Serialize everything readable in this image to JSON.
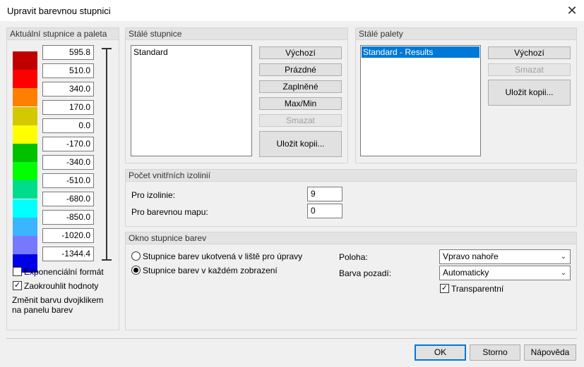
{
  "window": {
    "title": "Upravit barevnou stupnici"
  },
  "current": {
    "header": "Aktuální stupnice a paleta",
    "values": [
      "595.8",
      "510.0",
      "340.0",
      "170.0",
      "0.0",
      "-170.0",
      "-340.0",
      "-510.0",
      "-680.0",
      "-850.0",
      "-1020.0",
      "-1344.4"
    ],
    "colors": [
      "#c00000",
      "#ff0000",
      "#ff8000",
      "#d4c800",
      "#ffff00",
      "#00c000",
      "#00ff00",
      "#00dc8c",
      "#00ffff",
      "#3cb4ff",
      "#7878ff",
      "#0000e6"
    ],
    "exponential_label": "Exponenciální formát",
    "exponential_checked": false,
    "round_label": "Zaokrouhlit hodnoty",
    "round_checked": true,
    "hint": "Změnit barvu dvojklikem na panelu barev"
  },
  "scales": {
    "header": "Stálé stupnice",
    "items": [
      "Standard"
    ],
    "buttons": {
      "default": "Výchozí",
      "empty": "Prázdné",
      "filled": "Zaplněné",
      "maxmin": "Max/Min",
      "delete": "Smazat",
      "save_copy": "Uložit kopii..."
    }
  },
  "palettes": {
    "header": "Stálé palety",
    "items": [
      "Standard - Results"
    ],
    "buttons": {
      "default": "Výchozí",
      "delete": "Smazat",
      "save_copy": "Uložit kopii..."
    }
  },
  "isolines": {
    "header": "Počet vnitřních izolinií",
    "isolines_label": "Pro izolinie:",
    "isolines_value": "9",
    "colormap_label": "Pro barevnou mapu:",
    "colormap_value": "0"
  },
  "scale_window": {
    "header": "Okno stupnice barev",
    "radio1": "Stupnice barev ukotvená v liště pro úpravy",
    "radio2": "Stupnice barev v každém zobrazení",
    "selected_radio": 2,
    "position_label": "Poloha:",
    "position_value": "Vpravo nahoře",
    "bg_label": "Barva pozadí:",
    "bg_value": "Automaticky",
    "transparent_label": "Transparentní",
    "transparent_checked": true
  },
  "footer": {
    "ok": "OK",
    "cancel": "Storno",
    "help": "Nápověda"
  }
}
